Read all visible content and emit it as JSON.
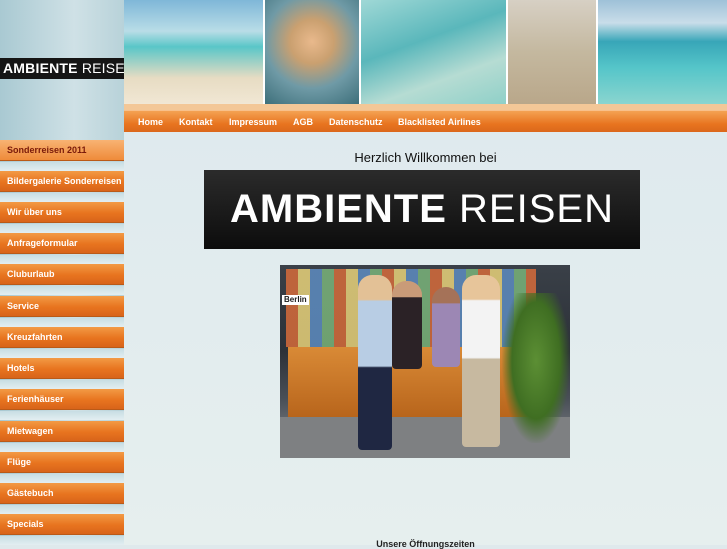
{
  "brand": {
    "name_bold": "AMBIENTE",
    "name_light": "REISEN"
  },
  "top_nav": [
    "Home",
    "Kontakt",
    "Impressum",
    "AGB",
    "Datenschutz",
    "Blacklisted Airlines"
  ],
  "side_nav": [
    {
      "label": "Sonderreisen 2011",
      "active": true
    },
    {
      "label": "Bildergalerie Sonderreisen",
      "active": false
    },
    {
      "label": "Wir über uns",
      "active": false
    },
    {
      "label": "Anfrageformular",
      "active": false
    },
    {
      "label": "Cluburlaub",
      "active": false
    },
    {
      "label": "Service",
      "active": false
    },
    {
      "label": "Kreuzfahrten",
      "active": false
    },
    {
      "label": "Hotels",
      "active": false
    },
    {
      "label": "Ferienhäuser",
      "active": false
    },
    {
      "label": "Mietwagen",
      "active": false
    },
    {
      "label": "Flüge",
      "active": false
    },
    {
      "label": "Gästebuch",
      "active": false
    },
    {
      "label": "Specials",
      "active": false
    }
  ],
  "main": {
    "welcome": "Herzlich Willkommen bei",
    "photo_sign": "Berlin",
    "hours_title": "Unsere Öffnungszeiten"
  },
  "colors": {
    "nav_orange": "#e8741f",
    "active_text": "#7a1a0a",
    "banner_bg": "#111111"
  }
}
